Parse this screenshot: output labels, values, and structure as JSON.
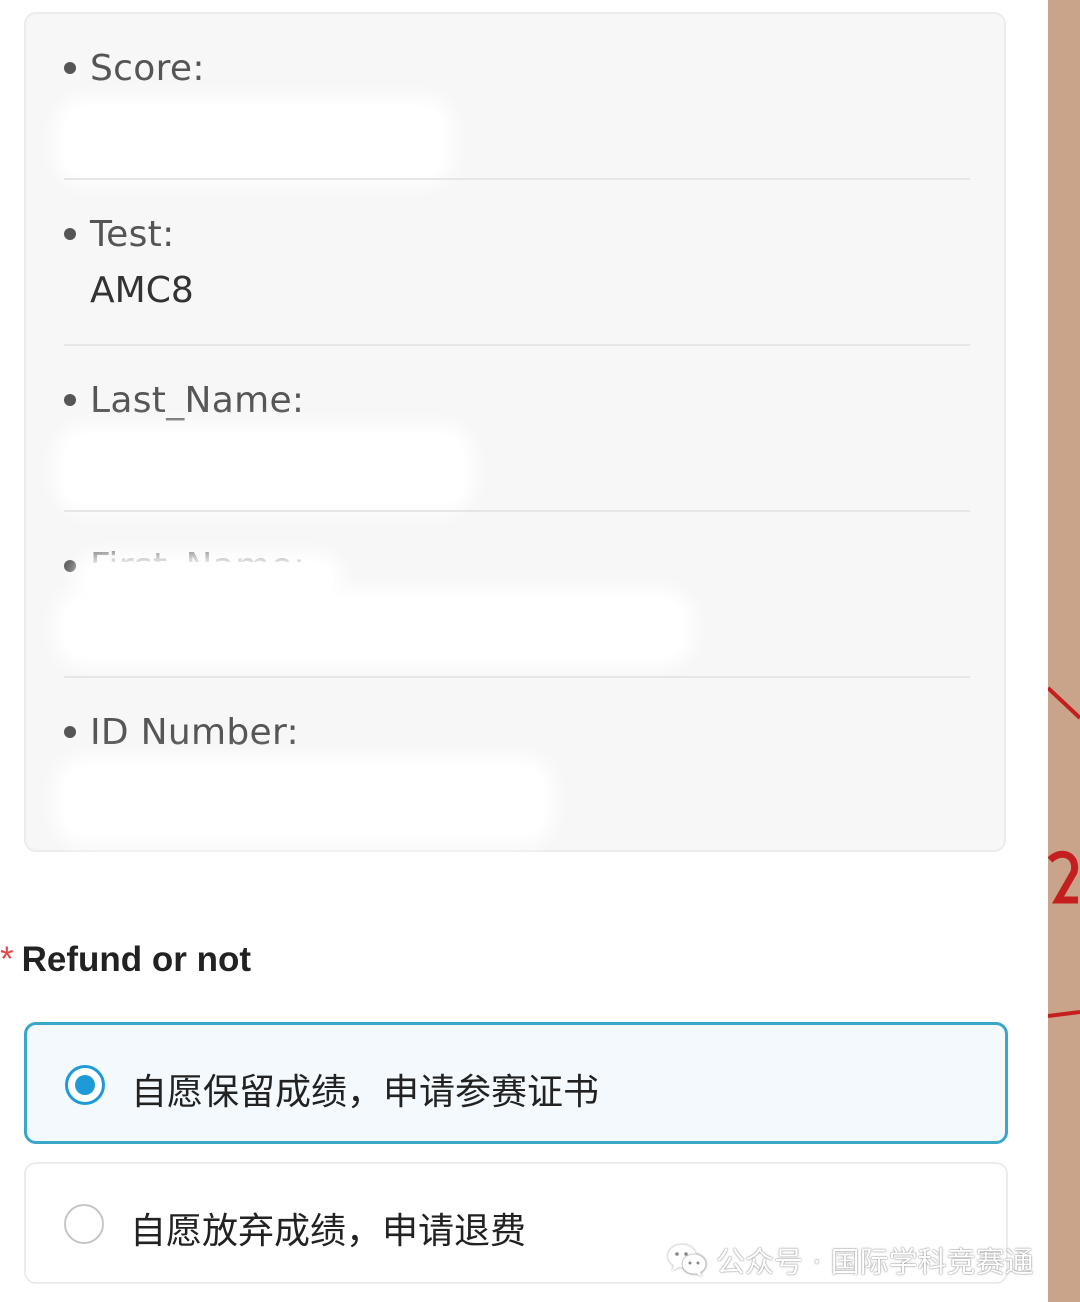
{
  "fields": [
    {
      "label": "Score:",
      "value": ""
    },
    {
      "label": "Test:",
      "value": "AMC8"
    },
    {
      "label": "Last_Name:",
      "value": ""
    },
    {
      "label": "First_Name:",
      "value": ""
    },
    {
      "label": "ID Number:",
      "value": ""
    }
  ],
  "refund": {
    "required_mark": "*",
    "title": "Refund or not",
    "options": [
      {
        "label": "自愿保留成绩，申请参赛证书",
        "selected": true
      },
      {
        "label": "自愿放弃成绩，申请退费",
        "selected": false
      }
    ]
  },
  "watermark": {
    "text": "公众号 · 国际学科竞赛通",
    "icon": "wechat-icon"
  },
  "colors": {
    "accent": "#1e9bd7",
    "selected_border": "#3aa7c9",
    "required": "#e84a4a"
  }
}
